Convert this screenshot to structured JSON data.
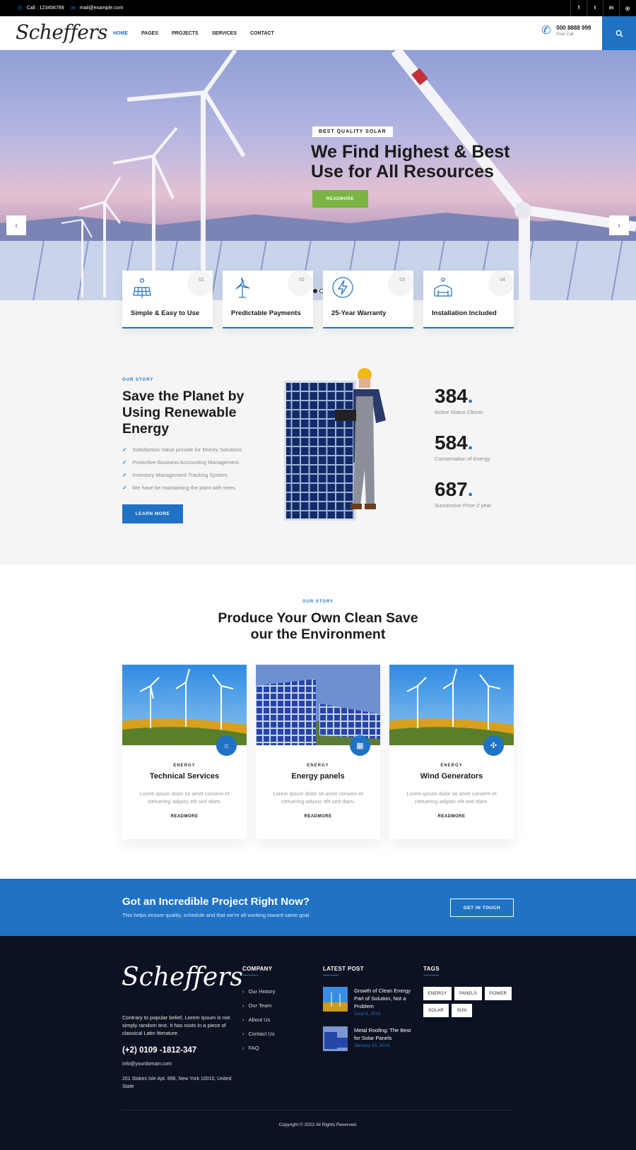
{
  "topbar": {
    "call": "Call : 123456789",
    "email": "mail@example.com",
    "social": [
      "f",
      "t",
      "in",
      "◎"
    ]
  },
  "header": {
    "logo": "Scheffers",
    "nav": [
      "HOME",
      "PAGES",
      "PROJECTS",
      "SERVICES",
      "CONTACT"
    ],
    "phone": "000 8888 999",
    "phone_sub": "Free Call"
  },
  "hero": {
    "badge": "BEST QUALITY SOLAR",
    "title": "We Find Highest & Best Use for All Resources",
    "button": "READMORE"
  },
  "features": [
    {
      "num": "01",
      "label": "Simple & Easy to Use",
      "icon": "solar-panel-icon"
    },
    {
      "num": "02",
      "label": "Predictable Payments",
      "icon": "wind-turbine-icon"
    },
    {
      "num": "03",
      "label": "25-Year Warranty",
      "icon": "lightning-icon"
    },
    {
      "num": "04",
      "label": "Installation Included",
      "icon": "house-icon"
    }
  ],
  "story": {
    "eyebrow": "OUR STORY",
    "title": "Save the Planet by Using Renewable Energy",
    "checks": [
      "Satisfaction Value provide for Money Solutions.",
      "Protective Business Accounting Management.",
      "Inventory Management Tracking System.",
      "We have be maintaining the plant with trees."
    ],
    "button": "LEARN MORE",
    "stats": [
      {
        "value": "384",
        "label": "Active Status Clients"
      },
      {
        "value": "584",
        "label": "Conservation of Energy"
      },
      {
        "value": "687",
        "label": "Successive Prize 2 year"
      }
    ]
  },
  "services": {
    "eyebrow": "OUR STORY",
    "title_line1": "Produce Your Own Clean Save",
    "title_line2": "our the Environment",
    "cards": [
      {
        "category": "ENERGY",
        "title": "Technical Services",
        "desc": "Lorem ipsum dolor sit amet consem et ctetuering adipisc elit sed diam.",
        "link": "READMORE"
      },
      {
        "category": "ENERGY",
        "title": "Energy panels",
        "desc": "Lorem ipsum dolor sit amet consem et ctetuering adipisc elit sed diam.",
        "link": "READMORE"
      },
      {
        "category": "ENERGY",
        "title": "Wind Generators",
        "desc": "Lorem ipsum dolor sit amet consem et ctetuering adipisc elit sed diam.",
        "link": "READMORE"
      }
    ]
  },
  "cta": {
    "title": "Got an Incredible Project Right Now?",
    "subtitle": "This helps ensure quality, schedule and that we're all working toward same goal",
    "button": "GET IN TOUCH"
  },
  "footer": {
    "logo": "Scheffers",
    "desc": "Contrary to popular belief, Lorem Ipsum is not simply random text. It has roots in a piece of classical Latin literature.",
    "phone": "(+2) 0109 -1812-347",
    "email": "info@yourdomain.com",
    "address": "201 Stokes Isle Apt. 896, New York 10010, United State",
    "company_heading": "COMPANY",
    "company_links": [
      "Our History",
      "Our Team",
      "About Us",
      "Contact Us",
      "FAQ"
    ],
    "posts_heading": "LATEST POST",
    "posts": [
      {
        "title": "Growth of Clean Energy Part of Solution, Not a Problem",
        "date": "June 9, 2019"
      },
      {
        "title": "Metal Roofing: The Best for Solar Panels",
        "date": "January 23, 2019"
      }
    ],
    "tags_heading": "TAGS",
    "tags": [
      "ENERGY",
      "PANELS",
      "POWER",
      "SOLAR",
      "SUN"
    ],
    "copyright": "Copyright © 2022 All Rights Reserved."
  },
  "colors": {
    "accent": "#1f72c4",
    "green": "#7cb342",
    "footer_bg": "#0d1222",
    "topbar_bg": "#000000"
  }
}
